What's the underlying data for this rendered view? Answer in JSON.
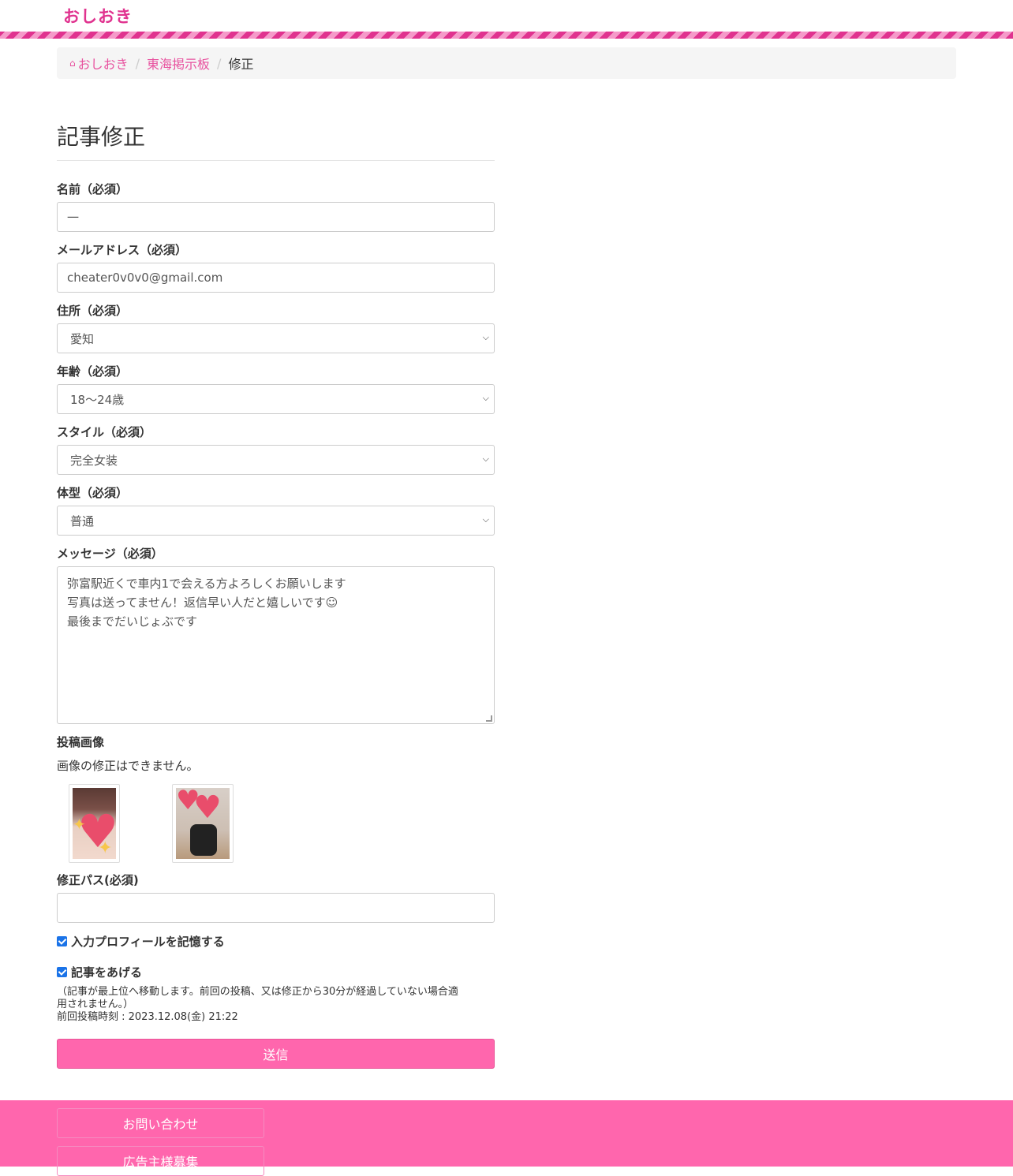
{
  "site": {
    "logo": "おしおき"
  },
  "breadcrumb": {
    "home_icon": "home-icon",
    "items": [
      "おしおき",
      "東海掲示板"
    ],
    "current": "修正"
  },
  "form": {
    "title": "記事修正",
    "name": {
      "label": "名前（必須）",
      "value": "一"
    },
    "email": {
      "label": "メールアドレス（必須）",
      "value": "cheater0v0v0@gmail.com"
    },
    "address": {
      "label": "住所（必須）",
      "value": "愛知"
    },
    "age": {
      "label": "年齢（必須）",
      "value": "18〜24歳"
    },
    "style": {
      "label": "スタイル（必須）",
      "value": "完全女装"
    },
    "body_type": {
      "label": "体型（必須）",
      "value": "普通"
    },
    "message": {
      "label": "メッセージ（必須）",
      "lines": [
        "弥富駅近くで車内1で会える方よろしくお願いします",
        "写真は送ってません！返信早い人だと嬉しいです☺︎",
        "最後までだいじょぶです"
      ]
    },
    "images": {
      "label": "投稿画像",
      "note": "画像の修正はできません。"
    },
    "edit_pass": {
      "label": "修正パス(必須)",
      "value": ""
    },
    "remember": {
      "label": "入力プロフィールを記憶する",
      "checked": true
    },
    "bump": {
      "label": "記事をあげる",
      "checked": true,
      "note_line1": "（記事が最上位へ移動します。前回の投稿、又は修正から30分が経過していない場合適",
      "note_line2": "用されません。）",
      "last_post": "前回投稿時刻 : 2023.12.08(金) 21:22"
    },
    "submit": "送信"
  },
  "footer": {
    "links": [
      "お問い合わせ",
      "広告主様募集"
    ]
  },
  "colors": {
    "accent": "#ff66ad",
    "logo": "#e0338f",
    "link": "#e8529f"
  }
}
